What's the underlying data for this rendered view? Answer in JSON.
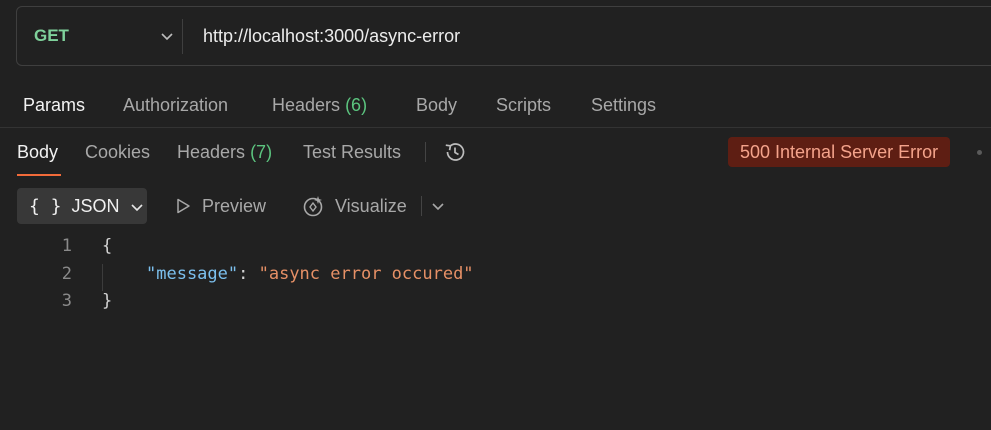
{
  "request": {
    "method": "GET",
    "url": "http://localhost:3000/async-error"
  },
  "request_tabs": {
    "params": "Params",
    "authorization": "Authorization",
    "headers_label": "Headers",
    "headers_count": "(6)",
    "body": "Body",
    "scripts": "Scripts",
    "settings": "Settings"
  },
  "response_tabs": {
    "body": "Body",
    "cookies": "Cookies",
    "headers_label": "Headers",
    "headers_count": "(7)",
    "test_results": "Test Results"
  },
  "status": {
    "text": "500 Internal Server Error",
    "color": "#5e1e13"
  },
  "format_bar": {
    "json_braces": "{ }",
    "json_label": "JSON",
    "preview": "Preview",
    "visualize": "Visualize"
  },
  "editor": {
    "lines": [
      {
        "num": "1",
        "open": "{"
      },
      {
        "num": "2",
        "key": "\"message\"",
        "colon": ": ",
        "value": "\"async error occured\""
      },
      {
        "num": "3",
        "close": "}"
      }
    ]
  },
  "icons": [
    "chevron-down-icon",
    "history-icon",
    "play-icon",
    "visualize-icon"
  ]
}
